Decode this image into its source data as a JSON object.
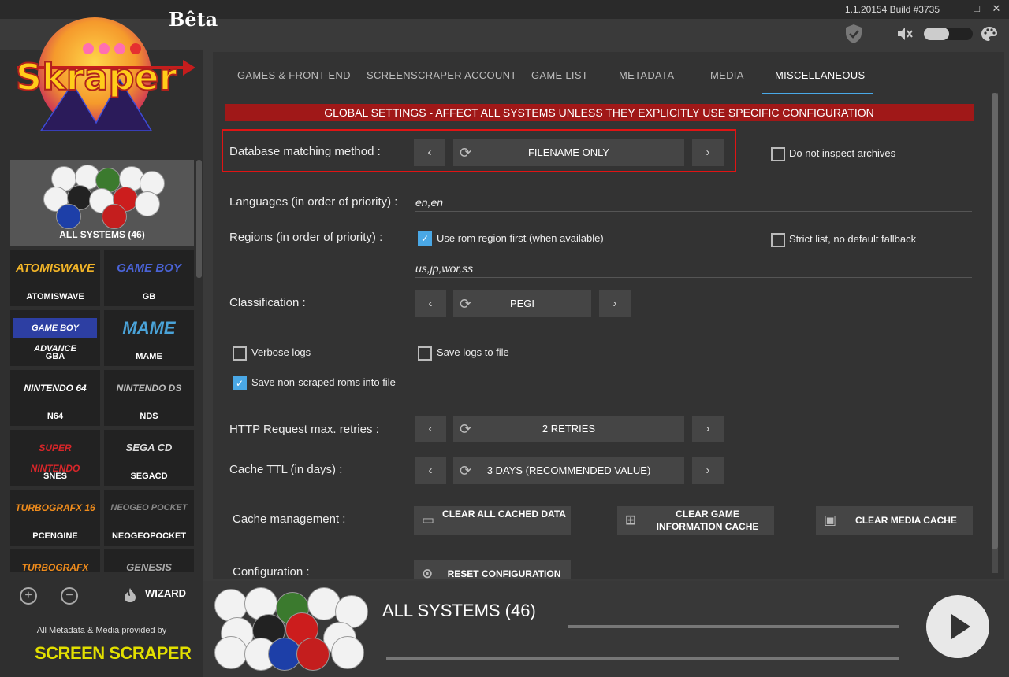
{
  "app": {
    "beta_label": "Bêta",
    "version": "1.1.20154 Build #3735",
    "logo_text": "Skraper"
  },
  "window": {
    "minimize": "–",
    "maximize": "□",
    "close": "✕"
  },
  "toolbar": {
    "shield_icon": "shield-check-icon",
    "mute_icon": "speaker-muted-icon",
    "palette_icon": "palette-icon"
  },
  "sidebar": {
    "all_systems": "ALL SYSTEMS (46)",
    "systems": [
      {
        "name": "ATOMISWAVE",
        "logo": "ATOMISWAVE",
        "color": "#f1b428"
      },
      {
        "name": "GB",
        "logo": "GAME BOY",
        "color": "#4a63d6"
      },
      {
        "name": "GBA",
        "logo": "GAME BOY ADVANCE",
        "color": "#ffffff"
      },
      {
        "name": "MAME",
        "logo": "MAME",
        "color": "#4aa3d8"
      },
      {
        "name": "N64",
        "logo": "NINTENDO 64",
        "color": "#ffffff"
      },
      {
        "name": "NDS",
        "logo": "NINTENDO DS",
        "color": "#bbbbbb"
      },
      {
        "name": "SNES",
        "logo": "SUPER NINTENDO",
        "color": "#d8262a"
      },
      {
        "name": "SEGACD",
        "logo": "SEGA CD",
        "color": "#dddddd"
      },
      {
        "name": "PCENGINE",
        "logo": "TURBOGRAFX 16",
        "color": "#f08c1c"
      },
      {
        "name": "NEOGEOPOCKET",
        "logo": "NEOGEO POCKET",
        "color": "#888888"
      },
      {
        "name": "",
        "logo": "TURBOGRAFX",
        "color": "#f08c1c"
      },
      {
        "name": "",
        "logo": "GENESIS",
        "color": "#aaaaaa"
      }
    ],
    "wizard_label": "WIZARD",
    "provided_by": "All Metadata & Media provided by",
    "brand": "SCREEN SCRAPER"
  },
  "tabs": [
    {
      "label": "GAMES & FRONT-END"
    },
    {
      "label": "SCREENSCRAPER ACCOUNT"
    },
    {
      "label": "GAME LIST"
    },
    {
      "label": "METADATA"
    },
    {
      "label": "MEDIA"
    },
    {
      "label": "MISCELLANEOUS"
    }
  ],
  "settings": {
    "banner": "GLOBAL SETTINGS - AFFECT ALL SYSTEMS UNLESS THEY EXPLICITLY USE SPECIFIC CONFIGURATION",
    "db_match_label": "Database matching method :",
    "db_match_value": "FILENAME ONLY",
    "no_inspect_archives": "Do not inspect archives",
    "languages_label": "Languages (in order of priority) :",
    "languages_value": "en,en",
    "regions_label": "Regions (in order of priority) :",
    "use_rom_region": "Use rom region first (when available)",
    "strict_list": "Strict list, no default fallback",
    "regions_value": "us,jp,wor,ss",
    "classification_label": "Classification :",
    "classification_value": "PEGI",
    "verbose_logs": "Verbose logs",
    "save_logs": "Save logs to file",
    "save_nonscraped": "Save non-scraped roms into file",
    "http_label": "HTTP Request max. retries :",
    "http_value": "2 RETRIES",
    "cache_ttl_label": "Cache TTL (in days) :",
    "cache_ttl_value": "3 DAYS (RECOMMENDED VALUE)",
    "cache_mgmt_label": "Cache management :",
    "clear_all_cached": "CLEAR ALL CACHED DATA",
    "clear_game_info": "CLEAR GAME INFORMATION CACHE",
    "clear_media": "CLEAR MEDIA CACHE",
    "configuration_label": "Configuration :",
    "reset_config": "RESET CONFIGURATION"
  },
  "bottom": {
    "title": "ALL SYSTEMS (46)"
  }
}
